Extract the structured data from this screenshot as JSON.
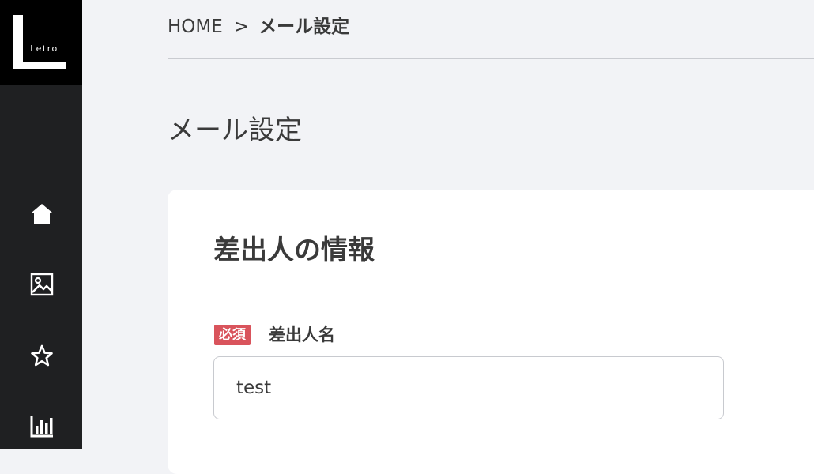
{
  "app": {
    "logo_text": "Letro"
  },
  "sidebar": {
    "items": [
      {
        "icon": "home-icon"
      },
      {
        "icon": "image-icon"
      },
      {
        "icon": "star-icon"
      },
      {
        "icon": "bar-chart-icon"
      }
    ]
  },
  "breadcrumb": {
    "home": "HOME",
    "separator": ">",
    "current": "メール設定"
  },
  "page": {
    "title": "メール設定"
  },
  "sender_section": {
    "title": "差出人の情報",
    "sender_name": {
      "required_badge": "必須",
      "label": "差出人名",
      "value": "test"
    }
  },
  "colors": {
    "sidebar_bg": "#1f2022",
    "logo_bg": "#000000",
    "page_bg": "#f2f3f6",
    "required_badge": "#d9545c"
  }
}
